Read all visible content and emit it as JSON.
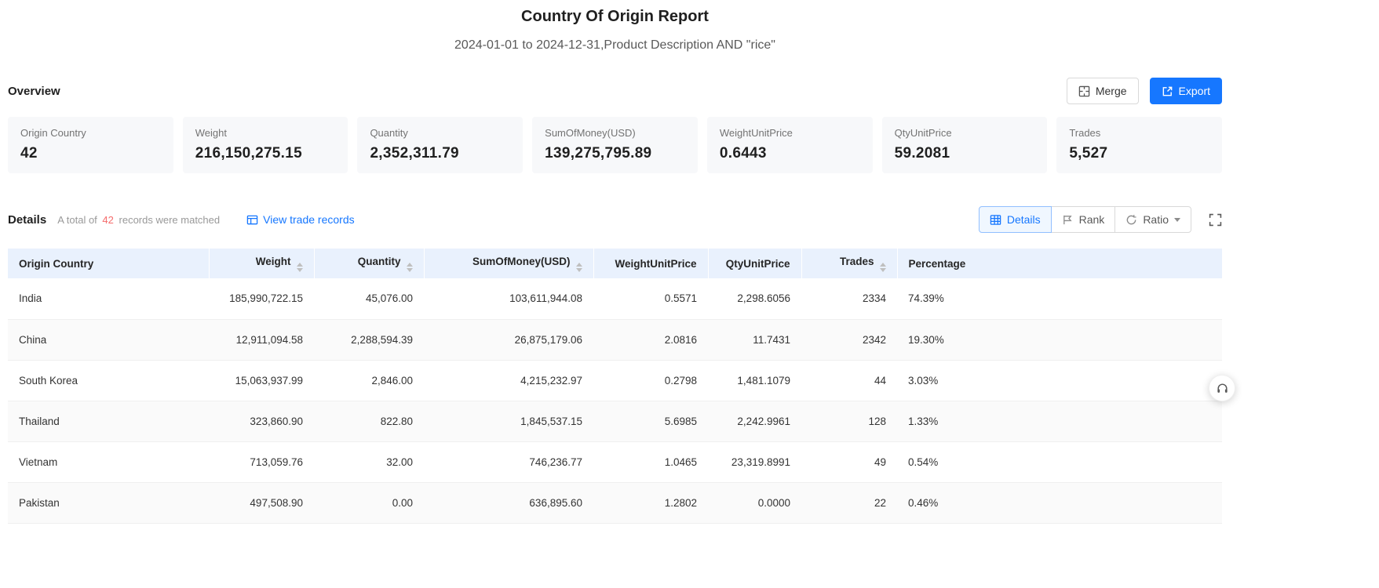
{
  "colors": {
    "accent": "#1677ff",
    "highlight": "#f56c6c"
  },
  "header": {
    "title": "Country Of Origin Report",
    "subtitle": "2024-01-01 to 2024-12-31,Product Description AND \"rice\""
  },
  "overview": {
    "label": "Overview",
    "merge_label": "Merge",
    "export_label": "Export",
    "cards": [
      {
        "label": "Origin Country",
        "value": "42"
      },
      {
        "label": "Weight",
        "value": "216,150,275.15"
      },
      {
        "label": "Quantity",
        "value": "2,352,311.79"
      },
      {
        "label": "SumOfMoney(USD)",
        "value": "139,275,795.89"
      },
      {
        "label": "WeightUnitPrice",
        "value": "0.6443"
      },
      {
        "label": "QtyUnitPrice",
        "value": "59.2081"
      },
      {
        "label": "Trades",
        "value": "5,527"
      }
    ]
  },
  "details": {
    "label": "Details",
    "match_prefix": "A total of",
    "match_count": "42",
    "match_suffix": "records were matched",
    "view_link_label": "View trade records",
    "tabs": [
      {
        "label": "Details",
        "active": true
      },
      {
        "label": "Rank",
        "active": false
      },
      {
        "label": "Ratio",
        "active": false,
        "dropdown": true
      }
    ]
  },
  "table": {
    "columns": [
      {
        "label": "Origin Country",
        "sortable": false,
        "align": "left"
      },
      {
        "label": "Weight",
        "sortable": true,
        "align": "right"
      },
      {
        "label": "Quantity",
        "sortable": true,
        "align": "right"
      },
      {
        "label": "SumOfMoney(USD)",
        "sortable": true,
        "align": "right"
      },
      {
        "label": "WeightUnitPrice",
        "sortable": false,
        "align": "right"
      },
      {
        "label": "QtyUnitPrice",
        "sortable": false,
        "align": "right"
      },
      {
        "label": "Trades",
        "sortable": true,
        "align": "right"
      },
      {
        "label": "Percentage",
        "sortable": false,
        "align": "left"
      }
    ],
    "rows": [
      [
        "India",
        "185,990,722.15",
        "45,076.00",
        "103,611,944.08",
        "0.5571",
        "2,298.6056",
        "2334",
        "74.39%"
      ],
      [
        "China",
        "12,911,094.58",
        "2,288,594.39",
        "26,875,179.06",
        "2.0816",
        "11.7431",
        "2342",
        "19.30%"
      ],
      [
        "South Korea",
        "15,063,937.99",
        "2,846.00",
        "4,215,232.97",
        "0.2798",
        "1,481.1079",
        "44",
        "3.03%"
      ],
      [
        "Thailand",
        "323,860.90",
        "822.80",
        "1,845,537.15",
        "5.6985",
        "2,242.9961",
        "128",
        "1.33%"
      ],
      [
        "Vietnam",
        "713,059.76",
        "32.00",
        "746,236.77",
        "1.0465",
        "23,319.8991",
        "49",
        "0.54%"
      ],
      [
        "Pakistan",
        "497,508.90",
        "0.00",
        "636,895.60",
        "1.2802",
        "0.0000",
        "22",
        "0.46%"
      ]
    ]
  }
}
